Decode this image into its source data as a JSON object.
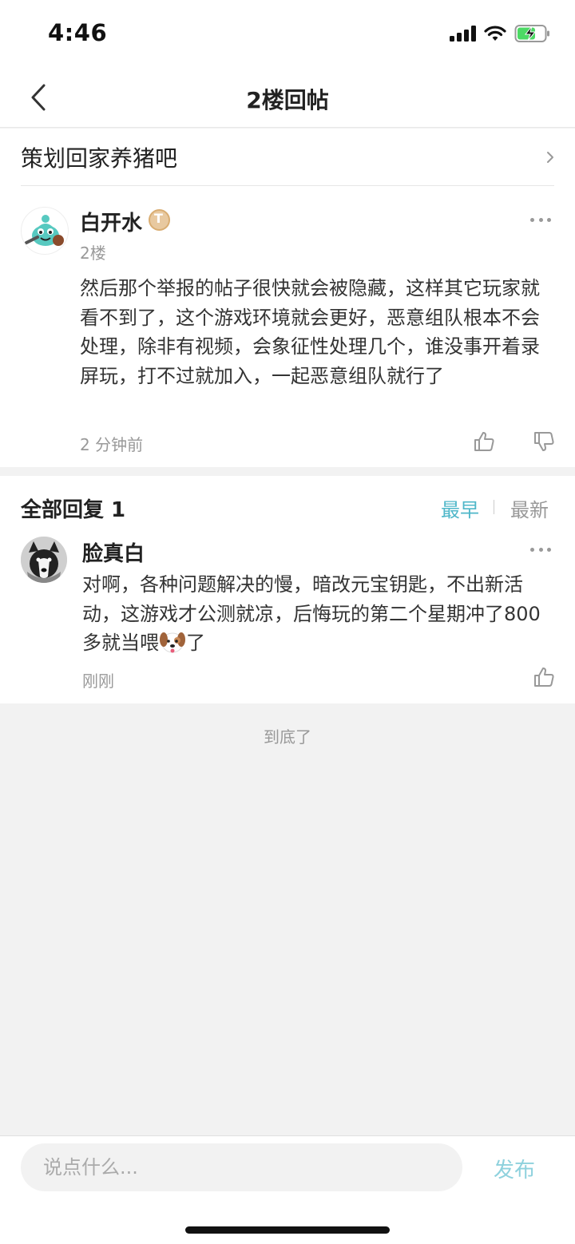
{
  "status_bar": {
    "time": "4:46"
  },
  "nav": {
    "title": "2楼回帖"
  },
  "forum": {
    "name": "策划回家养猪吧"
  },
  "post": {
    "username": "白开水",
    "badge_text": "T",
    "floor": "2楼",
    "content": "然后那个举报的帖子很快就会被隐藏，这样其它玩家就看不到了，这个游戏环境就会更好，恶意组队根本不会处理，除非有视频，会象征性处理几个，谁没事开着录屏玩，打不过就加入，一起恶意组队就行了",
    "time": "2 分钟前"
  },
  "replies": {
    "title": "全部回复 1",
    "sort_earliest": "最早",
    "sort_newest": "最新",
    "items": [
      {
        "username": "脸真白",
        "content_before_emoji": "对啊，各种问题解决的慢，暗改元宝钥匙，不出新活动，这游戏才公测就凉，后悔玩的第二个星期冲了800多就当喂",
        "content_after_emoji": "了",
        "time": "刚刚"
      }
    ]
  },
  "end_text": "到底了",
  "bottom_bar": {
    "placeholder": "说点什么...",
    "publish_label": "发布"
  },
  "colors": {
    "accent": "#4fb7c9",
    "publish": "#8ed1dd",
    "background": "#f2f2f2"
  }
}
